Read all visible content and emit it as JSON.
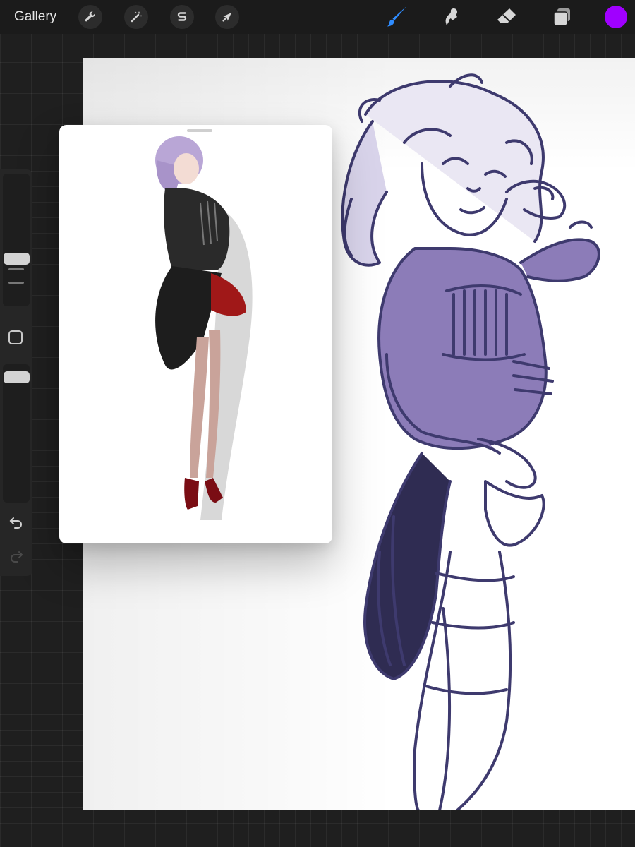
{
  "toolbar": {
    "gallery_label": "Gallery",
    "left_tools": [
      {
        "icon": "wrench-icon",
        "name": "actions"
      },
      {
        "icon": "magic-wand-icon",
        "name": "adjustments"
      },
      {
        "icon": "selection-s-icon",
        "name": "selection"
      },
      {
        "icon": "arrow-cursor-icon",
        "name": "transform"
      }
    ],
    "right_tools": [
      {
        "icon": "brush-icon",
        "name": "paint",
        "active": true
      },
      {
        "icon": "smudge-icon",
        "name": "smudge",
        "active": false
      },
      {
        "icon": "eraser-icon",
        "name": "erase",
        "active": false
      },
      {
        "icon": "layers-icon",
        "name": "layers",
        "active": false
      }
    ],
    "current_color": "#a000ff"
  },
  "colors": {
    "accent_brush": "#2f8cff",
    "sketch_line": "#3e3a6e",
    "sketch_fill": "#8c7cb8",
    "app_background": "#1f1f1f"
  },
  "sidebar": {
    "brush_size_icon": "brush-size-slider",
    "opacity_icon": "opacity-slider",
    "modify_icon": "square-modify-icon",
    "undo_icon": "undo-icon",
    "redo_icon": "redo-icon"
  },
  "reference": {
    "image_description_icon": "reference-image-icon"
  }
}
